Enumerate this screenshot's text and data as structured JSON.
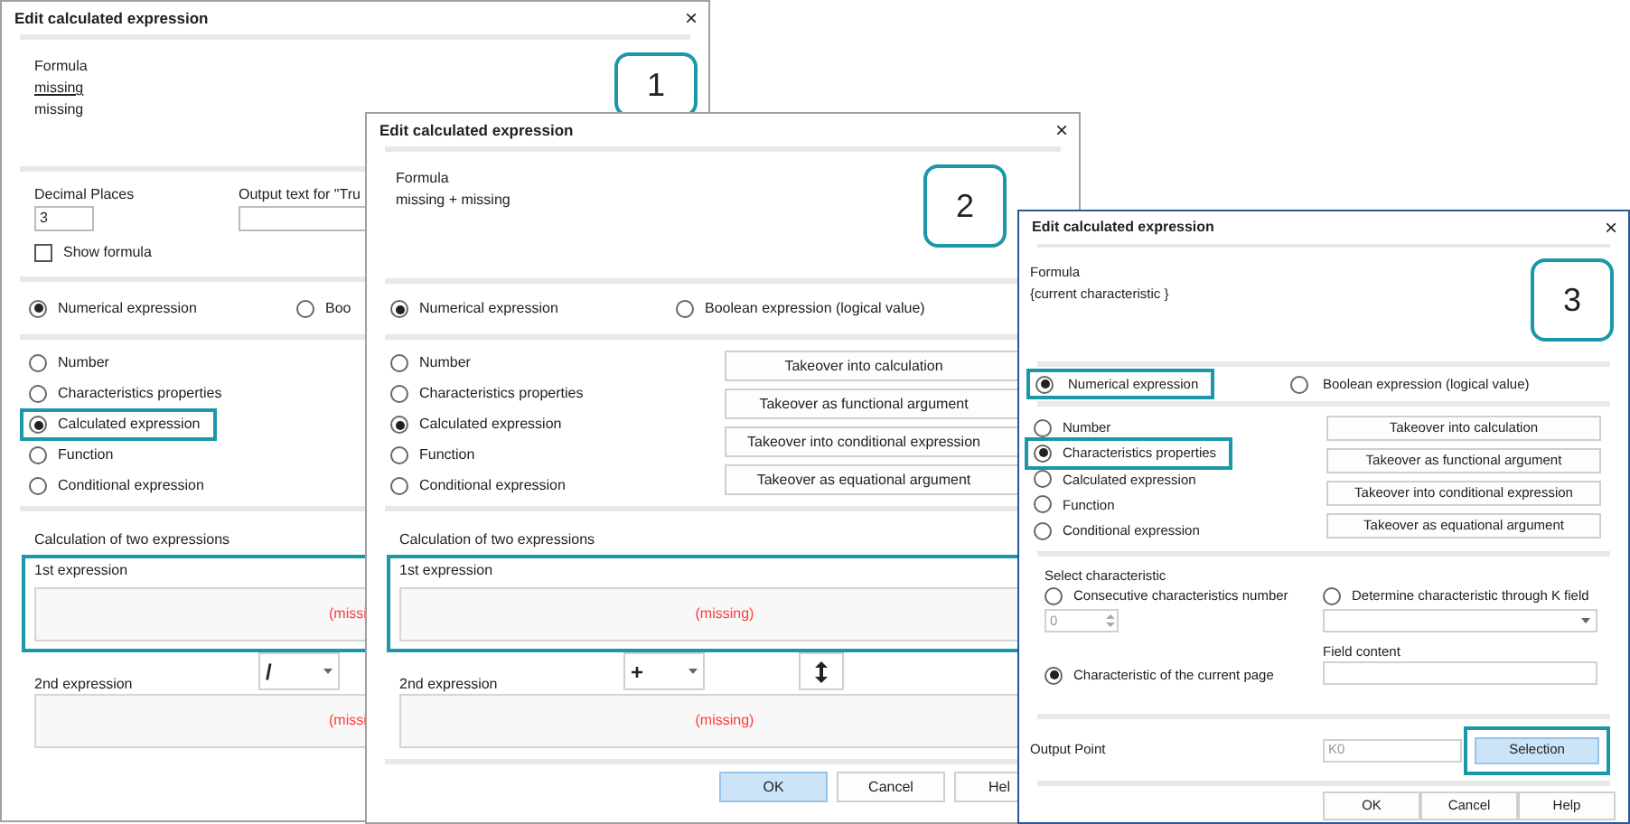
{
  "dialogs": [
    {
      "title": "Edit calculated expression",
      "active": false,
      "close": "×",
      "badge": "1",
      "formula": {
        "label": "Formula",
        "lines": [
          {
            "text": "missing",
            "underlined": true
          },
          {
            "text": "missing",
            "underlined": false
          }
        ]
      },
      "decimal_places": {
        "label": "Decimal Places",
        "value": "3"
      },
      "output_text": {
        "label": "Output text for \"Tru"
      },
      "show_formula": {
        "label": "Show formula",
        "checked": false
      },
      "expression_type": [
        {
          "label": "Numerical expression",
          "selected": true,
          "highlighted": false
        },
        {
          "label": "Boo",
          "selected": false,
          "highlighted": false
        }
      ],
      "operand_types": [
        {
          "label": "Number",
          "selected": false,
          "highlighted": false
        },
        {
          "label": "Characteristics properties",
          "selected": false,
          "highlighted": false
        },
        {
          "label": "Calculated expression",
          "selected": true,
          "highlighted": true
        },
        {
          "label": "Function",
          "selected": false,
          "highlighted": false
        },
        {
          "label": "Conditional expression",
          "selected": false,
          "highlighted": false
        }
      ],
      "calculation": {
        "label": "Calculation of two expressions",
        "first": {
          "label": "1st expression",
          "value": "(missi",
          "highlighted": true
        },
        "operator": "/",
        "second": {
          "label": "2nd expression",
          "value": "(missi",
          "highlighted": false
        }
      }
    },
    {
      "title": "Edit calculated expression",
      "active": false,
      "close": "×",
      "badge": "2",
      "formula": {
        "label": "Formula",
        "lines": [
          {
            "text": "missing + missing",
            "underlined": false
          }
        ]
      },
      "expression_type": [
        {
          "label": "Numerical expression",
          "selected": true,
          "highlighted": false
        },
        {
          "label": "Boolean expression (logical value)",
          "selected": false,
          "highlighted": false
        }
      ],
      "operand_types": [
        {
          "label": "Number",
          "selected": false,
          "highlighted": false
        },
        {
          "label": "Characteristics properties",
          "selected": false,
          "highlighted": false
        },
        {
          "label": "Calculated expression",
          "selected": true,
          "highlighted": false
        },
        {
          "label": "Function",
          "selected": false,
          "highlighted": false
        },
        {
          "label": "Conditional expression",
          "selected": false,
          "highlighted": false
        }
      ],
      "takeover_buttons": [
        "Takeover into calculation",
        "Takeover as functional argument",
        "Takeover into conditional expression",
        "Takeover as equational argument"
      ],
      "calculation": {
        "label": "Calculation of two expressions",
        "first": {
          "label": "1st expression",
          "value": "(missing)",
          "highlighted": true
        },
        "operator": "+",
        "second": {
          "label": "2nd expression",
          "value": "(missing)",
          "highlighted": false
        }
      },
      "buttons": [
        {
          "label": "OK",
          "default": true
        },
        {
          "label": "Cancel",
          "default": false
        },
        {
          "label": "Hel",
          "default": false
        }
      ]
    },
    {
      "title": "Edit calculated expression",
      "active": true,
      "close": "×",
      "badge": "3",
      "formula": {
        "label": "Formula",
        "lines": [
          {
            "text": "{current characteristic }",
            "underlined": false
          }
        ]
      },
      "expression_type": [
        {
          "label": "Numerical expression",
          "selected": true,
          "highlighted": true
        },
        {
          "label": "Boolean expression (logical value)",
          "selected": false,
          "highlighted": false
        }
      ],
      "operand_types": [
        {
          "label": "Number",
          "selected": false,
          "highlighted": false
        },
        {
          "label": "Characteristics properties",
          "selected": true,
          "highlighted": true
        },
        {
          "label": "Calculated expression",
          "selected": false,
          "highlighted": false
        },
        {
          "label": "Function",
          "selected": false,
          "highlighted": false
        },
        {
          "label": "Conditional expression",
          "selected": false,
          "highlighted": false
        }
      ],
      "takeover_buttons": [
        "Takeover into calculation",
        "Takeover as functional argument",
        "Takeover into conditional expression",
        "Takeover as equational argument"
      ],
      "select_characteristic": {
        "label": "Select characteristic",
        "options": [
          {
            "label": "Consecutive characteristics number",
            "selected": false
          },
          {
            "label": "Determine characteristic through K field",
            "selected": false
          },
          {
            "label": "Characteristic of the current page",
            "selected": true
          }
        ],
        "number_value": "0",
        "number_disabled": true,
        "field_content_label": "Field content"
      },
      "output_point": {
        "label": "Output Point",
        "value": "K0",
        "disabled": true,
        "button": {
          "label": "Selection",
          "default": true,
          "highlighted": true
        }
      },
      "buttons": [
        {
          "label": "OK",
          "default": false
        },
        {
          "label": "Cancel",
          "default": false
        },
        {
          "label": "Help",
          "default": false
        }
      ]
    }
  ]
}
